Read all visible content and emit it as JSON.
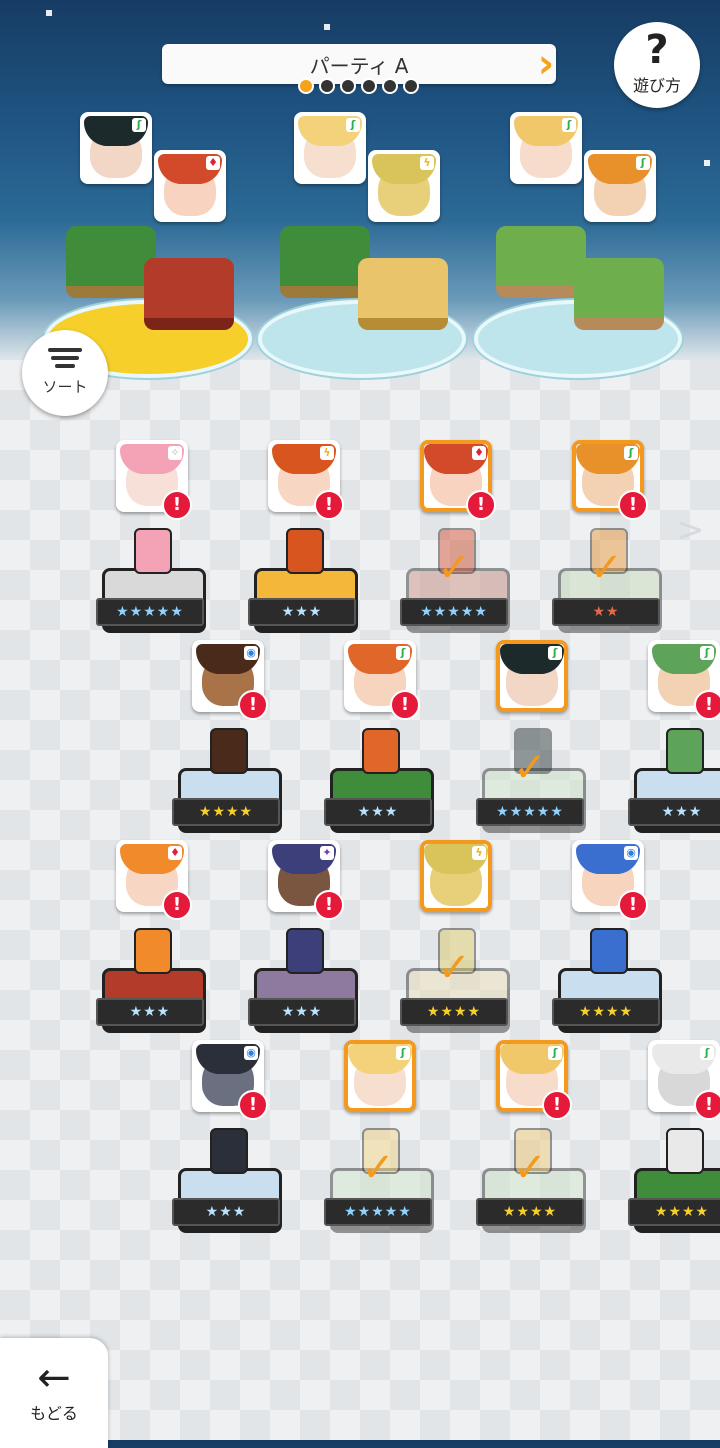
{
  "header": {
    "party_title": "パーティ A",
    "page_count": 6,
    "active_page": 0
  },
  "buttons": {
    "help_symbol": "?",
    "help_label": "遊び方",
    "sort_label": "ソート",
    "back_symbol": "←",
    "back_label": "もどる",
    "side_arrow": ">"
  },
  "party": [
    {
      "members": [
        {
          "element": "leaf",
          "element_color": "#27b24a",
          "hair": "#1c2a2c",
          "skin": "#f2d6c6"
        },
        {
          "element": "fire",
          "element_color": "#e0213a",
          "hair": "#d24a2a",
          "skin": "#f7d3c0"
        }
      ],
      "disc": "gold"
    },
    {
      "members": [
        {
          "element": "leaf",
          "element_color": "#27b24a",
          "hair": "#f4d27a",
          "skin": "#f7dfd0"
        },
        {
          "element": "bolt",
          "element_color": "#f2b61c",
          "hair": "#d8c45a",
          "skin": "#e8d07a"
        }
      ],
      "disc": "teal"
    },
    {
      "members": [
        {
          "element": "leaf",
          "element_color": "#27b24a",
          "hair": "#f0c86a",
          "skin": "#f7dccb"
        },
        {
          "element": "leaf",
          "element_color": "#27b24a",
          "hair": "#e8902a",
          "skin": "#f3d2b3"
        }
      ],
      "disc": "teal"
    }
  ],
  "roster": [
    {
      "hair": "#f3a3b5",
      "skin": "#f7e0d8",
      "element": "✧",
      "element_color": "#bbbbbb",
      "selected": false,
      "stars": "★★★★★",
      "star_color": "#8fd3ff",
      "pedestal": "#d9d9d9",
      "alert": "!"
    },
    {
      "hair": "#d8551f",
      "skin": "#f7d6c3",
      "element": "ϟ",
      "element_color": "#f2b61c",
      "selected": false,
      "stars": "★★★",
      "star_color": "#b9e2ff",
      "pedestal": "#f5b73a",
      "alert": "!"
    },
    {
      "hair": "#d24a2a",
      "skin": "#f7d3c0",
      "element": "♦",
      "element_color": "#e0213a",
      "selected": true,
      "stars": "★★★★★",
      "star_color": "#8fd3ff",
      "pedestal": "#c98a7a",
      "alert": "!"
    },
    {
      "hair": "#e8902a",
      "skin": "#f3d2b3",
      "element": "ʃ",
      "element_color": "#27b24a",
      "selected": true,
      "stars": "★★",
      "star_color": "#e06a4a",
      "pedestal": "#c2d8b6",
      "alert": "!"
    },
    {
      "hair": "#4a2a1a",
      "skin": "#a9734a",
      "element": "◉",
      "element_color": "#2a7de1",
      "selected": false,
      "stars": "★★★★",
      "star_color": "#f6cf2a",
      "pedestal": "#c9dff0",
      "alert": "!"
    },
    {
      "hair": "#e0662a",
      "skin": "#f6d4be",
      "element": "ʃ",
      "element_color": "#27b24a",
      "selected": false,
      "stars": "★★★",
      "star_color": "#b9e2ff",
      "pedestal": "#3f8d3a",
      "alert": "!"
    },
    {
      "hair": "#1c2a2c",
      "skin": "#f2d6c6",
      "element": "ʃ",
      "element_color": "#27b24a",
      "selected": true,
      "stars": "★★★★★",
      "star_color": "#8fd3ff",
      "pedestal": "#cfe3c8",
      "alert": ""
    },
    {
      "hair": "#5ea35a",
      "skin": "#f3d2b3",
      "element": "ʃ",
      "element_color": "#27b24a",
      "selected": false,
      "stars": "★★★",
      "star_color": "#b9e2ff",
      "pedestal": "#c9dff0",
      "alert": "!"
    },
    {
      "hair": "#f08a2a",
      "skin": "#f7d6c3",
      "element": "♦",
      "element_color": "#e0213a",
      "selected": false,
      "stars": "★★★",
      "star_color": "#b9e2ff",
      "pedestal": "#b33b2a",
      "alert": "!"
    },
    {
      "hair": "#3d3f7a",
      "skin": "#7a5640",
      "element": "✦",
      "element_color": "#6a3fb0",
      "selected": false,
      "stars": "★★★",
      "star_color": "#b9e2ff",
      "pedestal": "#8e7a9e",
      "alert": "!"
    },
    {
      "hair": "#d8c45a",
      "skin": "#e8d07a",
      "element": "ϟ",
      "element_color": "#f2b61c",
      "selected": true,
      "stars": "★★★★",
      "star_color": "#f6cf2a",
      "pedestal": "#e9d9b0",
      "alert": ""
    },
    {
      "hair": "#3a6fd0",
      "skin": "#f6d4be",
      "element": "◉",
      "element_color": "#2a7de1",
      "selected": false,
      "stars": "★★★★",
      "star_color": "#f6cf2a",
      "pedestal": "#c9dff0",
      "alert": "!"
    },
    {
      "hair": "#2a2f3a",
      "skin": "#6a7080",
      "element": "◉",
      "element_color": "#2a7de1",
      "selected": false,
      "stars": "★★★",
      "star_color": "#b9e2ff",
      "pedestal": "#c9dff0",
      "alert": "!"
    },
    {
      "hair": "#f4d27a",
      "skin": "#f7dfd0",
      "element": "ʃ",
      "element_color": "#27b24a",
      "selected": true,
      "stars": "★★★★★",
      "star_color": "#8fd3ff",
      "pedestal": "#cfe3c8",
      "alert": ""
    },
    {
      "hair": "#f0c86a",
      "skin": "#f7dccb",
      "element": "ʃ",
      "element_color": "#27b24a",
      "selected": true,
      "stars": "★★★★",
      "star_color": "#f6cf2a",
      "pedestal": "#cfe3c8",
      "alert": "!"
    },
    {
      "hair": "#e9e9e9",
      "skin": "#d8d8d8",
      "element": "ʃ",
      "element_color": "#27b24a",
      "selected": false,
      "stars": "★★★★",
      "star_color": "#f6cf2a",
      "pedestal": "#3f8d3a",
      "alert": "!"
    }
  ]
}
